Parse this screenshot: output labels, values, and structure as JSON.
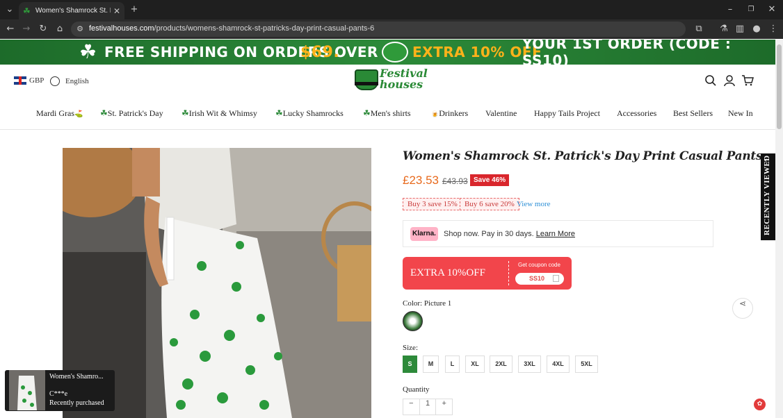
{
  "browser": {
    "tab_title": "Women's Shamrock St. Patrick's",
    "url_host": "festivalhouses.com",
    "url_path": "/products/womens-shamrock-st-patricks-day-print-casual-pants-6"
  },
  "banner": {
    "text1": "FREE SHIPPING ON ORDERS OVER",
    "amount": "$69.",
    "text2": "EXTRA 10% OFF",
    "text3": "YOUR 1ST ORDER (CODE : SS10)"
  },
  "header": {
    "currency": "GBP",
    "language": "English",
    "logo_text1": "Festival",
    "logo_text2": "houses"
  },
  "nav": [
    {
      "label": "Mardi Gras",
      "emoji": "⛳"
    },
    {
      "label": "St. Patrick's Day",
      "emoji": "☘"
    },
    {
      "label": "Irish Wit & Whimsy",
      "emoji": "☘"
    },
    {
      "label": "Lucky Shamrocks",
      "emoji": "☘"
    },
    {
      "label": "Men's shirts",
      "emoji": "☘"
    },
    {
      "label": "Drinkers",
      "emoji": "🍺"
    },
    {
      "label": "Valentine",
      "emoji": ""
    },
    {
      "label": "Happy Tails Project",
      "emoji": ""
    },
    {
      "label": "Accessories",
      "emoji": ""
    },
    {
      "label": "Best Sellers",
      "emoji": ""
    },
    {
      "label": "New In",
      "emoji": ""
    }
  ],
  "product": {
    "title": "Women's Shamrock St. Patrick's Day Print Casual Pants",
    "price": "£23.53",
    "old_price": "£43.93",
    "save": "Save 46%",
    "offers": [
      "Buy 3 save 15%",
      "Buy 6 save 20%"
    ],
    "view_more": "View more",
    "klarna_badge": "Klarna.",
    "klarna_text": "Shop now. Pay in 30 days.",
    "klarna_link": "Learn More",
    "coupon_title": "EXTRA 10%OFF",
    "coupon_get": "Get coupon code",
    "coupon_code": "SS10",
    "color_label": "Color: Picture 1",
    "size_label": "Size:",
    "sizes": [
      "S",
      "M",
      "L",
      "XL",
      "2XL",
      "3XL",
      "4XL",
      "5XL"
    ],
    "selected_size": "S",
    "quantity_label": "Quantity",
    "quantity": "1",
    "minus": "−",
    "plus": "+"
  },
  "recently_viewed": "RECENTLY VIEWED",
  "popup": {
    "title": "Women's Shamro...",
    "buyer": "C***e",
    "status": "Recently purchased"
  },
  "colors": {
    "accent_green": "#2d8a3a",
    "price_orange": "#e86a1d",
    "sale_red": "#d9262c"
  }
}
